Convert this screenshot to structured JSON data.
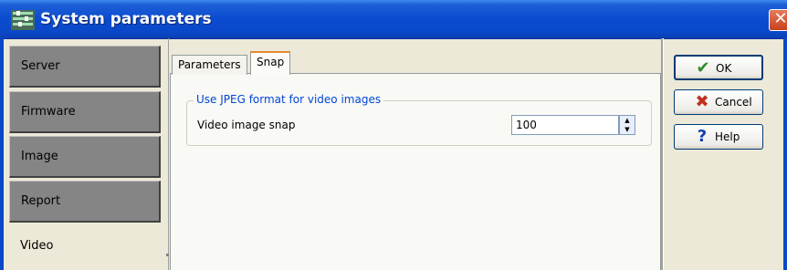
{
  "window": {
    "title": "System parameters",
    "close_glyph": "✕"
  },
  "nav": {
    "items": [
      {
        "label": "Server"
      },
      {
        "label": "Firmware"
      },
      {
        "label": "Image"
      },
      {
        "label": "Report"
      },
      {
        "label": "Video",
        "selected": true
      }
    ]
  },
  "tabs": [
    {
      "label": "Parameters"
    },
    {
      "label": "Snap",
      "active": true
    }
  ],
  "snap": {
    "group_title": "Use JPEG format for video images",
    "field_label": "Video image snap",
    "field_value": "100",
    "spin_up": "▲",
    "spin_down": "▼"
  },
  "buttons": {
    "ok": {
      "label": "OK",
      "icon": "check-icon",
      "glyph": "✔",
      "color": "#2e8b2e"
    },
    "cancel": {
      "label": "Cancel",
      "icon": "x-icon",
      "glyph": "✖",
      "color": "#c0301d"
    },
    "help": {
      "label": "Help",
      "icon": "question-icon",
      "glyph": "?",
      "color": "#1a3fb0"
    }
  },
  "colors": {
    "titlebar": "#0a4bd0",
    "accent_tab": "#e68b2c",
    "group_title": "#0046d5"
  }
}
